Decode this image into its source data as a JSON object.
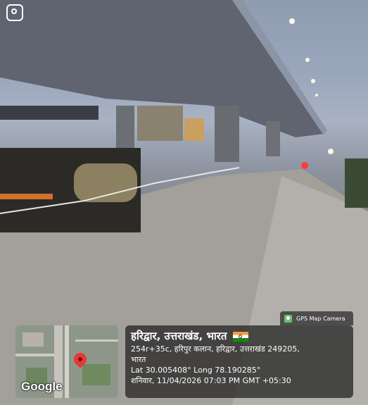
{
  "gps_camera": {
    "label": "GPS Map Camera"
  },
  "map": {
    "provider_logo": "Google"
  },
  "location": {
    "title": "हरिद्वार, उत्तराखंड, भारत",
    "address_line1": "254r+35c, हरिपुर कलान, हरिद्वार, उत्तराखंड 249205,",
    "address_line2": "भारत",
    "coords": "Lat 30.005408° Long 78.190285°",
    "datetime": "शनिवार, 11/04/2026 07:03 PM GMT +05:30"
  },
  "colors": {
    "overlay": "#282828",
    "pin": "#e53935",
    "flag_saffron": "#ff9933",
    "flag_green": "#138808"
  },
  "icons": [
    "camera-toggle-icon",
    "gps-map-camera-icon",
    "map-pin-icon",
    "india-flag-icon"
  ]
}
